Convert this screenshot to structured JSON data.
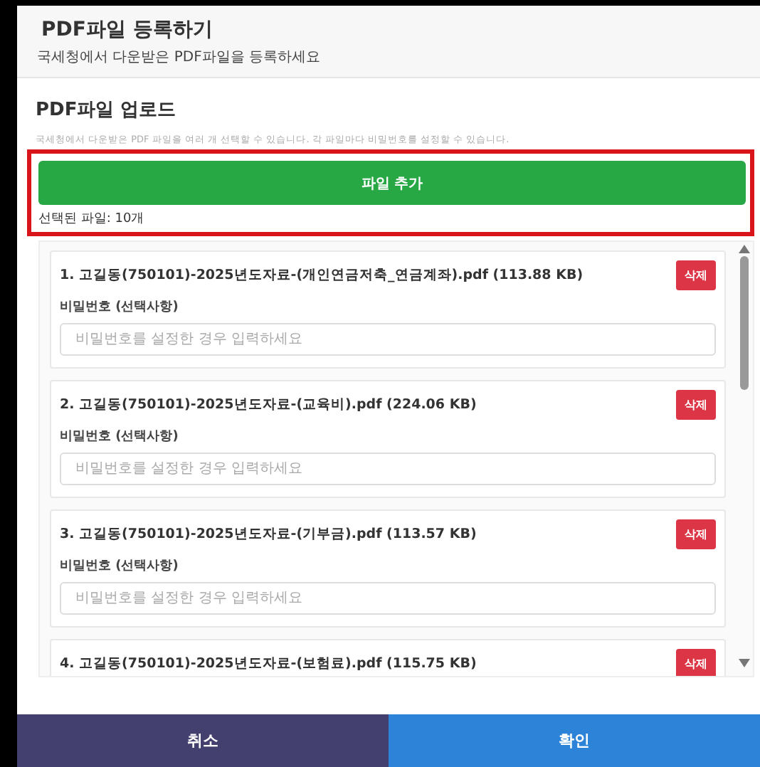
{
  "header": {
    "title": "PDF파일 등록하기",
    "subtitle": "국세청에서 다운받은 PDF파일을 등록하세요"
  },
  "upload": {
    "title": "PDF파일 업로드",
    "description": "국세청에서 다운받은 PDF 파일을 여러 개 선택할 수 있습니다. 각 파일마다 비밀번호를 설정할 수 있습니다.",
    "add_button": "파일 추가",
    "selected_count": "선택된 파일: 10개"
  },
  "files": [
    {
      "name": "1. 고길동(750101)-2025년도자료-(개인연금저축_연금계좌).pdf (113.88 KB)",
      "delete": "삭제",
      "password_label": "비밀번호 (선택사항)",
      "placeholder": "비밀번호를 설정한 경우 입력하세요"
    },
    {
      "name": "2. 고길동(750101)-2025년도자료-(교육비).pdf (224.06 KB)",
      "delete": "삭제",
      "password_label": "비밀번호 (선택사항)",
      "placeholder": "비밀번호를 설정한 경우 입력하세요"
    },
    {
      "name": "3. 고길동(750101)-2025년도자료-(기부금).pdf (113.57 KB)",
      "delete": "삭제",
      "password_label": "비밀번호 (선택사항)",
      "placeholder": "비밀번호를 설정한 경우 입력하세요"
    },
    {
      "name": "4. 고길동(750101)-2025년도자료-(보험료).pdf (115.75 KB)",
      "delete": "삭제"
    }
  ],
  "footer": {
    "cancel": "취소",
    "confirm": "확인"
  }
}
